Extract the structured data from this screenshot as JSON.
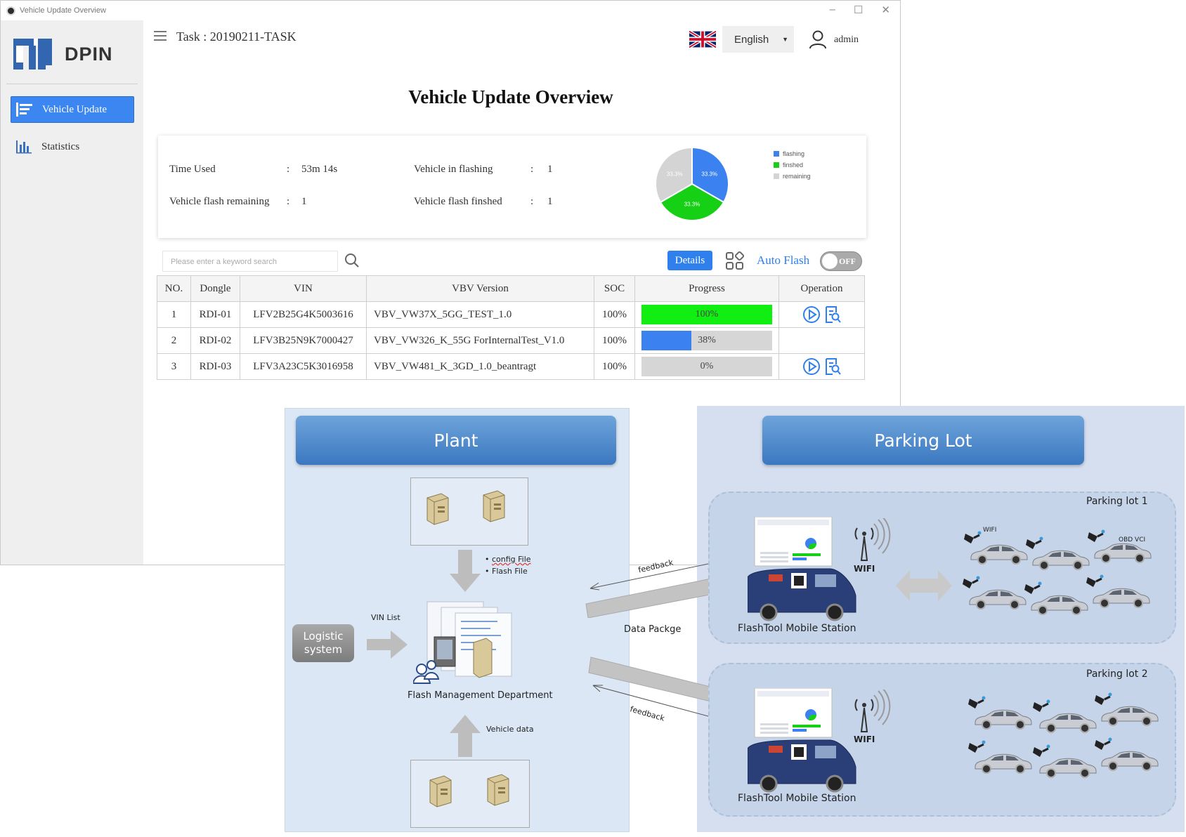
{
  "window": {
    "title": "Vehicle Update Overview",
    "controls": [
      "minimize-icon",
      "maximize-icon",
      "close-icon"
    ]
  },
  "brand": {
    "name": "DPIN",
    "logo_color": "#3366b0"
  },
  "sidebar": {
    "items": [
      {
        "label": "Vehicle Update",
        "icon": "list-icon",
        "active": true
      },
      {
        "label": "Statistics",
        "icon": "bar-chart-icon",
        "active": false
      }
    ]
  },
  "header": {
    "task": "Task : 20190211-TASK",
    "language": "English",
    "user": "admin"
  },
  "page": {
    "title": "Vehicle Update Overview"
  },
  "summary": {
    "time_used_label": "Time Used",
    "time_used_value": "53m 14s",
    "remaining_label": "Vehicle flash remaining",
    "remaining_value": "1",
    "in_flashing_label": "Vehicle in flashing",
    "in_flashing_value": "1",
    "finished_label": "Vehicle flash finshed",
    "finished_value": "1",
    "colon": ":"
  },
  "chart_data": {
    "type": "pie",
    "slices": [
      {
        "name": "flashing",
        "value": 33.3,
        "label": "33.3%",
        "color": "#3b82f0"
      },
      {
        "name": "finshed",
        "value": 33.3,
        "label": "33.3%",
        "color": "#16d016"
      },
      {
        "name": "remaining",
        "value": 33.3,
        "label": "33.3%",
        "color": "#d4d4d4"
      }
    ],
    "legend": [
      "flashing",
      "finshed",
      "remaining"
    ],
    "legend_position": "right"
  },
  "toolbar": {
    "search_placeholder": "Please enter a keyword search",
    "details_label": "Details",
    "auto_flash_label": "Auto Flash",
    "toggle_label": "OFF"
  },
  "table": {
    "headers": [
      "NO.",
      "Dongle",
      "VIN",
      "VBV Version",
      "SOC",
      "Progress",
      "Operation"
    ],
    "rows": [
      {
        "no": "1",
        "dongle": "RDI-01",
        "vin": "LFV2B25G4K5003616",
        "vbv": "VBV_VW37X_5GG_TEST_1.0",
        "soc": "100%",
        "progress": 1.0,
        "progress_label": "100%",
        "progress_color": "#11ee11",
        "ops": true
      },
      {
        "no": "2",
        "dongle": "RDI-02",
        "vin": "LFV3B25N9K7000427",
        "vbv": "VBV_VW326_K_55G ForInternalTest_V1.0",
        "soc": "100%",
        "progress": 0.38,
        "progress_label": "38%",
        "progress_color": "#3b82f0",
        "ops": false
      },
      {
        "no": "3",
        "dongle": "RDI-03",
        "vin": "LFV3A23C5K3016958",
        "vbv": "VBV_VW481_K_3GD_1.0_beantragt",
        "soc": "100%",
        "progress": 0.0,
        "progress_label": "0%",
        "progress_color": "#3b82f0",
        "ops": true
      }
    ]
  },
  "diagram": {
    "plant_title": "Plant",
    "parking_title": "Parking Lot",
    "config_file": "config File",
    "flash_file": "Flash File",
    "vin_list": "VIN List",
    "logistic_line1": "Logistic",
    "logistic_line2": "system",
    "flash_mgmt": "Flash Management Department",
    "vehicle_data": "Vehicle data",
    "feedback": "feedback",
    "data_package": "Data Packge",
    "lot1": "Parking lot 1",
    "lot2": "Parking lot 2",
    "wifi": "WIFI",
    "station": "FlashTool Mobile Station",
    "car_wifi": "WIFI",
    "obd": "OBD VCI"
  }
}
